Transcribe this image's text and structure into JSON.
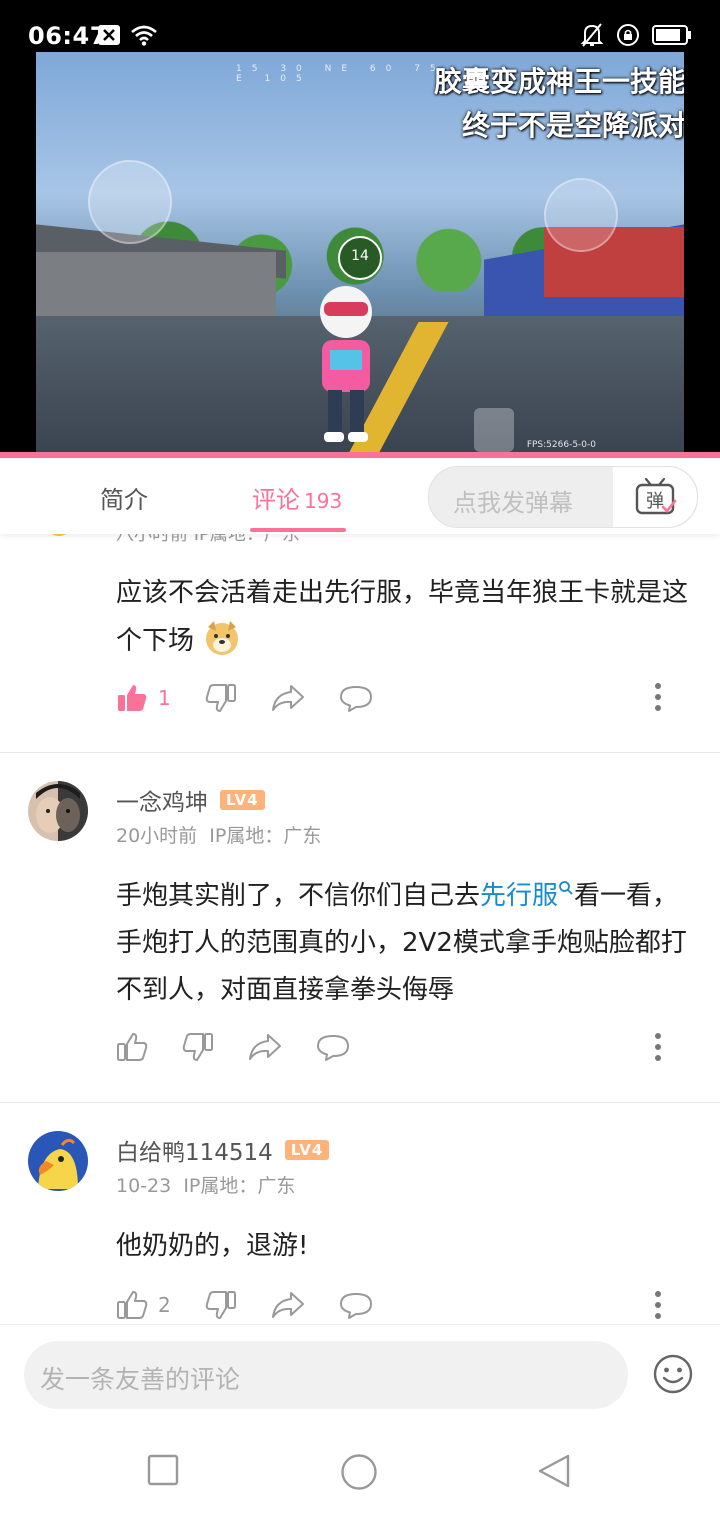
{
  "status_bar": {
    "time": "06:47",
    "left_icons": [
      "close-box-icon",
      "wifi-icon"
    ],
    "right_icons": [
      "bell-off-icon",
      "lock-rotation-icon",
      "battery-icon"
    ]
  },
  "video": {
    "overlay_line1": "胶囊变成神王一技能",
    "overlay_line2": "终于不是空降派对",
    "hud_badge": "14",
    "fps_text": "FPS:5266-5-0-0",
    "compass": "15 30 NE 60 75 E 105"
  },
  "tabs": {
    "intro": "简介",
    "comments": "评论",
    "comments_count": "193",
    "danmaku_placeholder": "点我发弹幕",
    "danmaku_button": "弹"
  },
  "comments": [
    {
      "meta_partial": "八小时前 IP属地：广东",
      "text": "应该不会活着走出先行服，毕竟当年狼王卡就是这个下场",
      "emoji": "doge",
      "likes": "1",
      "liked": true
    },
    {
      "username": "一念鸡坤",
      "level": "LV4",
      "time": "20小时前",
      "ip": "IP属地：广东",
      "text_before": "手炮其实削了，不信你们自己去",
      "link": "先行服",
      "text_after": "看一看，手炮打人的范围真的小，2V2模式拿手炮贴脸都打不到人，对面直接拿拳头侮辱",
      "likes": ""
    },
    {
      "username": "白给鸭114514",
      "level": "LV4",
      "time": "10-23",
      "ip": "IP属地：广东",
      "text": "他奶奶的，退游!",
      "likes": "2"
    }
  ],
  "bottom": {
    "reply_placeholder": "发一条友善的评论",
    "emoji_icon": "smiley-icon"
  },
  "nav": [
    "recents-square-icon",
    "home-circle-icon",
    "back-triangle-icon"
  ],
  "colors": {
    "accent": "#fb7299",
    "link": "#178bcf",
    "level_badge": "#ffb27a"
  }
}
